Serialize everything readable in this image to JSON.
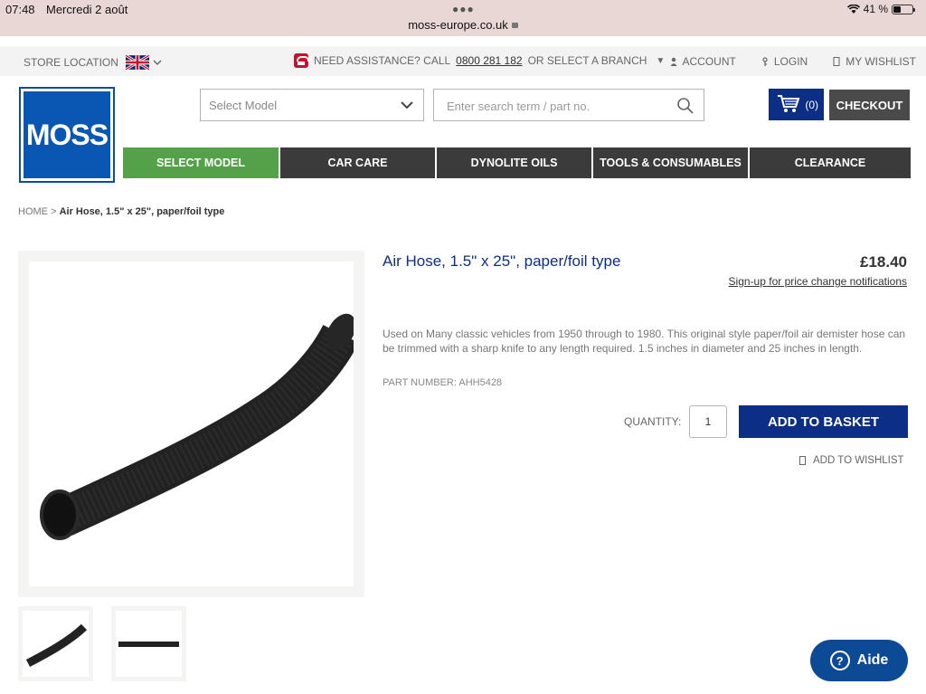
{
  "status_bar": {
    "time": "07:48",
    "date": "Mercredi 2 août",
    "url": "moss-europe.co.uk",
    "battery": "41 %"
  },
  "utility_bar": {
    "store_location": "STORE LOCATION",
    "help_prefix": "NEED ASSISTANCE? CALL",
    "phone": "0800 281 182",
    "help_suffix": "OR SELECT A BRANCH",
    "account": "ACCOUNT",
    "login": "LOGIN",
    "wishlist": "MY WISHLIST"
  },
  "header": {
    "logo_text": "MOSS",
    "select_model_placeholder": "Select Model",
    "search_placeholder": "Enter search term / part no.",
    "cart_count": "(0)",
    "checkout": "CHECKOUT"
  },
  "nav": {
    "items": [
      {
        "label": "SELECT MODEL"
      },
      {
        "label": "CAR CARE"
      },
      {
        "label": "DYNOLITE OILS"
      },
      {
        "label": "TOOLS & CONSUMABLES"
      },
      {
        "label": "CLEARANCE"
      }
    ]
  },
  "breadcrumb": {
    "home": "HOME",
    "separator": ">",
    "current": "Air Hose, 1.5\" x 25\", paper/foil type"
  },
  "product": {
    "title": "Air Hose, 1.5\" x 25\", paper/foil type",
    "price": "£18.40",
    "price_notify": "Sign-up for price change notifications",
    "description": "Used on Many classic vehicles from 1950 through to 1980. This original style paper/foil air demister hose can be trimmed with a sharp knife to any length required. 1.5 inches in diameter and 25 inches in length.",
    "part_number": "PART NUMBER: AHH5428",
    "quantity_label": "QUANTITY:",
    "quantity_value": "1",
    "add_to_basket": "ADD TO BASKET",
    "add_to_wishlist": "ADD TO WISHLIST"
  },
  "help_widget": {
    "label": "Aide"
  },
  "colors": {
    "brand_blue": "#0c2f85",
    "logo_blue": "#0a56b3",
    "nav_dark": "#3b3b3b",
    "nav_active": "#54a14a",
    "checkout_grey": "#4a4a4a"
  }
}
